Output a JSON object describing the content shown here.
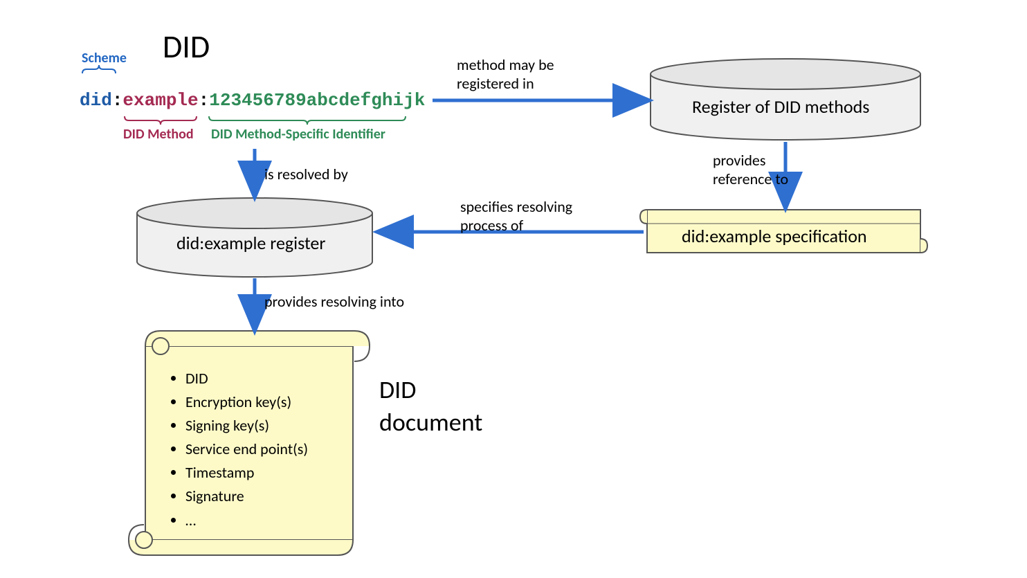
{
  "title": "DID",
  "did_parts": {
    "scheme_label": "Scheme",
    "scheme": "did",
    "method_label": "DID Method",
    "method": "example",
    "identifier_label": "DID Method-Specific Identifier",
    "identifier": "123456789abcdefghijk"
  },
  "edges": {
    "registered": "method may be\nregistered in",
    "resolved_by": "is resolved by",
    "provides_ref": "provides\nreference to",
    "specifies": "specifies resolving\nprocess of",
    "resolving_into": "provides resolving into"
  },
  "nodes": {
    "register_methods": "Register of DID methods",
    "example_register": "did:example register",
    "example_spec": "did:example specification"
  },
  "document": {
    "heading": "DID\ndocument",
    "items": [
      "DID",
      "Encryption key(s)",
      "Signing key(s)",
      "Service end point(s)",
      "Timestamp",
      "Signature",
      "…"
    ]
  }
}
